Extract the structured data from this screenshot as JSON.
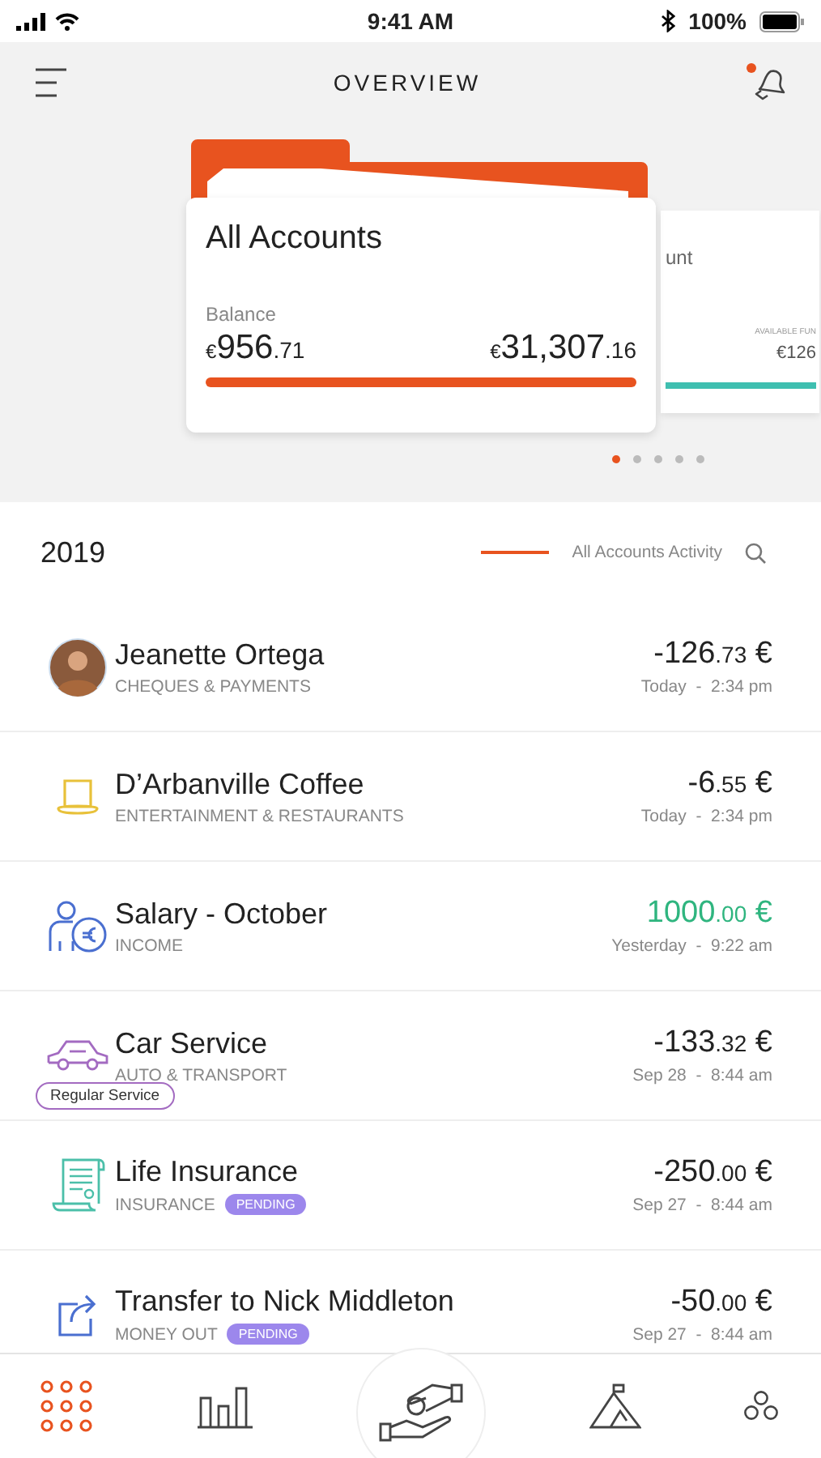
{
  "status_bar": {
    "time": "9:41 AM",
    "battery": "100%"
  },
  "header": {
    "title": "OVERVIEW",
    "notification": true
  },
  "carousel": {
    "card": {
      "title": "All Accounts",
      "label": "Balance",
      "left": {
        "currency": "€",
        "main": "956",
        "cents": ".71"
      },
      "right": {
        "currency": "€",
        "main": "31,307",
        "cents": ".16"
      }
    },
    "next_card": {
      "title": "unt",
      "label": "AVAILABLE FUN",
      "amount": "€126"
    },
    "pages": [
      {
        "selected": true
      },
      {
        "selected": false
      },
      {
        "selected": false
      },
      {
        "selected": false
      },
      {
        "selected": false
      }
    ]
  },
  "activity": {
    "year": "2019",
    "filter": "All Accounts Activity",
    "rows": [
      {
        "title": "Jeanette Ortega",
        "category": "CHEQUES & PAYMENTS",
        "kind": "debit",
        "amount": {
          "main": "-126",
          "cents": ".73",
          "currency": "€"
        },
        "time": "Today  -  2:34 pm"
      },
      {
        "title": "D’Arbanville Coffee",
        "category": "ENTERTAINMENT & RESTAURANTS",
        "kind": "debit",
        "amount": {
          "main": "-6",
          "cents": ".55",
          "currency": "€"
        },
        "time": "Today  -  2:34 pm"
      },
      {
        "title": "Salary - October",
        "category": "INCOME",
        "kind": "credit",
        "amount": {
          "main": "1000",
          "cents": ".00",
          "currency": "€"
        },
        "time": "Yesterday  -  9:22 am"
      },
      {
        "title": "Car Service",
        "category": "AUTO & TRANSPORT",
        "kind": "debit",
        "amount": {
          "main": "-133",
          "cents": ".32",
          "currency": "€"
        },
        "time": "Sep 28  -  8:44 am",
        "tag": "Regular Service"
      },
      {
        "title": "Life Insurance",
        "category": "INSURANCE",
        "badge": "PENDING",
        "kind": "debit",
        "amount": {
          "main": "-250",
          "cents": ".00",
          "currency": "€"
        },
        "time": "Sep 27  -  8:44 am"
      },
      {
        "title": "Transfer to Nick Middleton",
        "category": "MONEY OUT",
        "badge": "PENDING",
        "kind": "debit",
        "amount": {
          "main": "-50",
          "cents": ".00",
          "currency": "€"
        },
        "time": "Sep 27  -  8:44 am"
      }
    ]
  },
  "nav": [
    {
      "selected": true
    },
    {
      "selected": false
    },
    {
      "selected": false
    },
    {
      "selected": false
    },
    {
      "selected": false
    }
  ]
}
